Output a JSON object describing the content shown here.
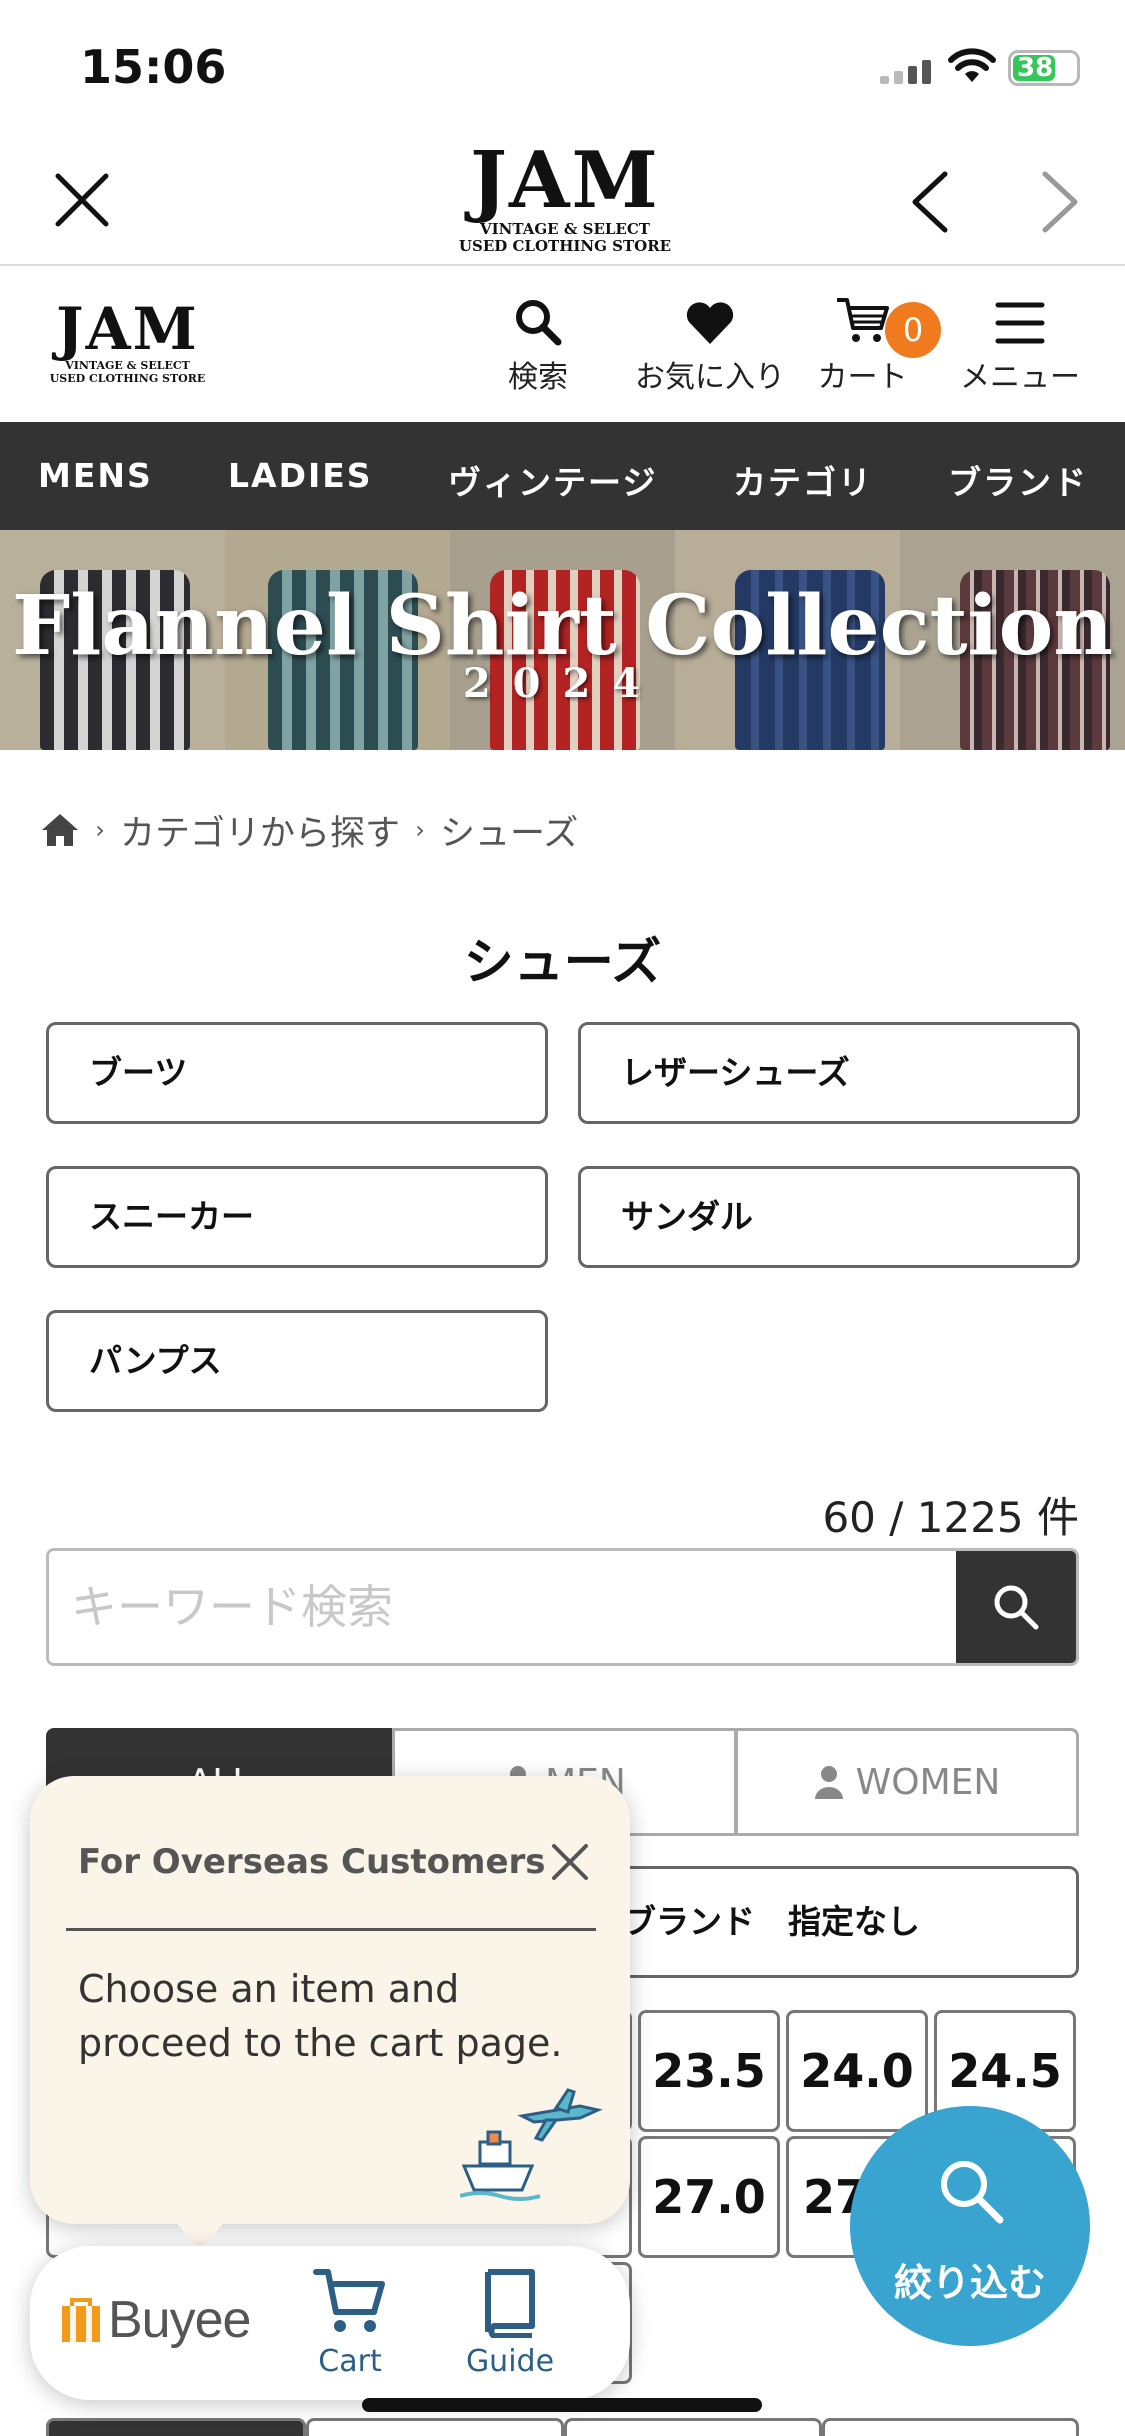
{
  "status_bar": {
    "time": "15:06",
    "battery": "38"
  },
  "site": {
    "logo_main": "JAM",
    "logo_sub1": "VINTAGE & SELECT",
    "logo_sub2": "USED CLOTHING STORE"
  },
  "header": {
    "search_label": "検索",
    "favorites_label": "お気に入り",
    "cart_label": "カート",
    "cart_count": "0",
    "menu_label": "メニュー"
  },
  "nav": [
    "MENS",
    "LADIES",
    "ヴィンテージ",
    "カテゴリ",
    "ブランド"
  ],
  "banner": {
    "title": "Flannel Shirt Collection",
    "year": "2024"
  },
  "breadcrumb": {
    "level1": "カテゴリから探す",
    "level2": "シューズ"
  },
  "page_title": "シューズ",
  "categories": [
    "ブーツ",
    "レザーシューズ",
    "スニーカー",
    "サンダル",
    "パンプス"
  ],
  "result_count": "60 / 1225 件",
  "search": {
    "placeholder": "キーワード検索"
  },
  "gender_tabs": {
    "all": "ALL",
    "men": "MEN",
    "women": "WOMEN"
  },
  "brand_select": "ブランド　指定なし",
  "sizes": {
    "row1": [
      "23.5",
      "24.0",
      "24.5"
    ],
    "row2": [
      "27.0",
      "27"
    ]
  },
  "popup": {
    "title": "For Overseas Customers",
    "body": "Choose an item and proceed to the cart page."
  },
  "buyee": {
    "logo": "Buyee",
    "cart": "Cart",
    "guide": "Guide"
  },
  "filter_button": "絞り込む",
  "colors": {
    "nav_bg": "#333333",
    "badge": "#f07b1e",
    "fab": "#3aa4d1",
    "popup_bg": "#fbf4e8",
    "buyee_blue": "#2d5f86",
    "buyee_orange": "#f39a1b"
  }
}
